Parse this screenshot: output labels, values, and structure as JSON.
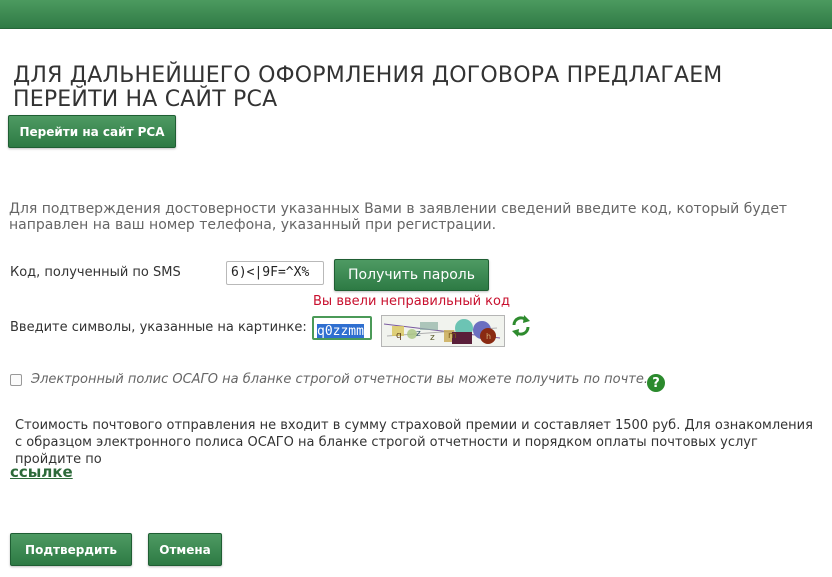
{
  "header": {
    "title": "ДЛЯ ДАЛЬНЕЙШЕГО ОФОРМЛЕНИЯ ДОГОВОРА ПРЕДЛАГАЕМ ПЕРЕЙТИ НА САЙТ РСА",
    "go_button_label": "Перейти на сайт РСА"
  },
  "verification": {
    "info_text": "Для подтверждения достоверности указанных Вами в заявлении сведений введите код, который будет направлен на ваш номер телефона, указанный при регистрации.",
    "sms_label": "Код, полученный по SMS",
    "sms_value": "6)<|9F=^X%",
    "get_password_label": "Получить пароль",
    "error_text": "Вы ввели неправильный код",
    "captcha_label": "Введите символы, указанные на картинке:",
    "captcha_value": "q0zzmm"
  },
  "postal": {
    "checkbox_label": "Электронный полис ОСАГО на бланке строгой отчетности вы можете получить по почте.",
    "checked": false,
    "help_icon": "question-circle-icon",
    "description": "Стоимость почтового отправления не входит в сумму страховой премии и составляет 1500 руб. Для ознакомления с образцом электронного полиса ОСАГО на бланке строгой отчетности и порядком оплаты почтовых услуг пройдите по",
    "link_text": "ссылке"
  },
  "actions": {
    "confirm_label": "Подтвердить",
    "cancel_label": "Отмена"
  },
  "colors": {
    "brand_green": "#2d7a44",
    "error_red": "#c8102e"
  }
}
